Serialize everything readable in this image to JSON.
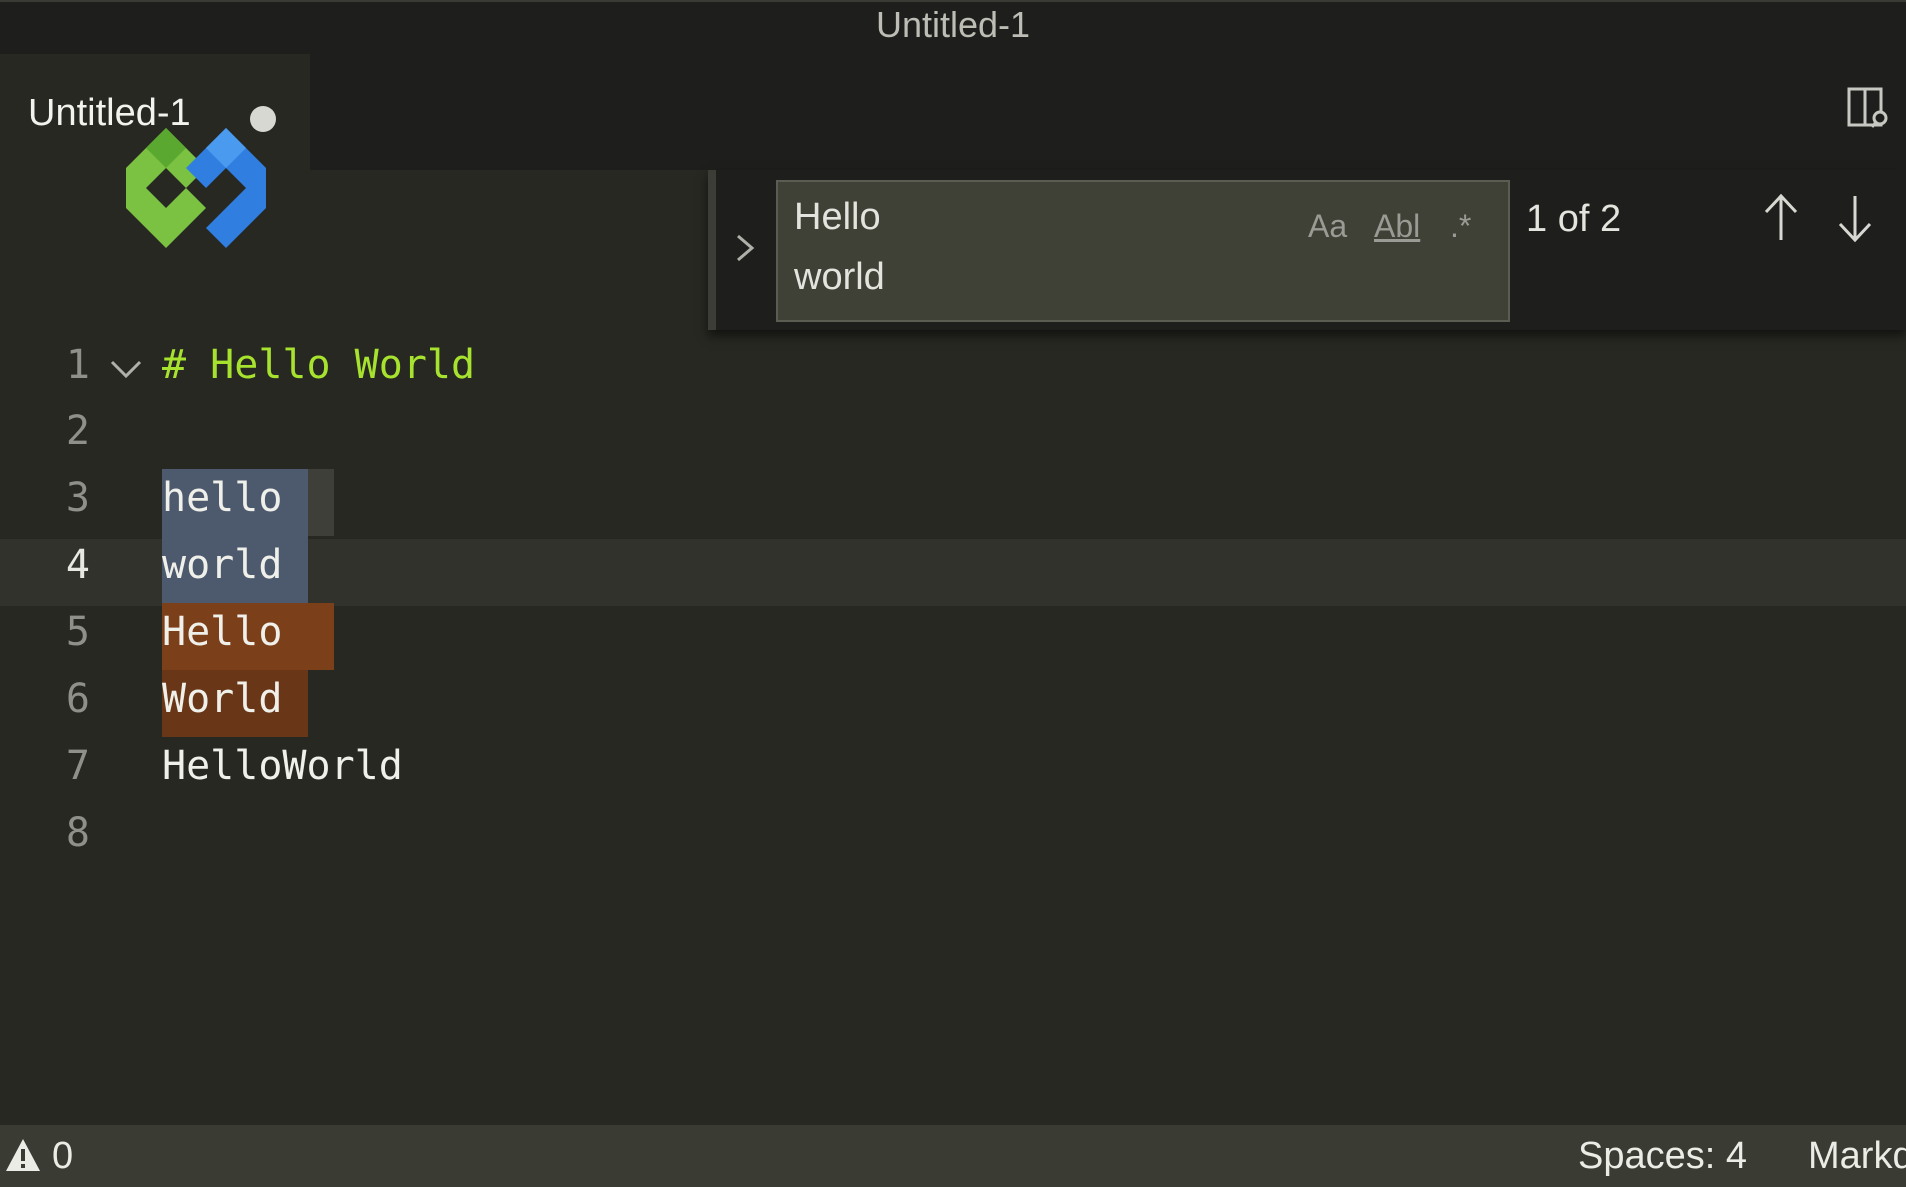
{
  "window": {
    "title": "Untitled-1"
  },
  "tabs": [
    {
      "label": "Untitled-1",
      "dirty": true
    }
  ],
  "icons": {
    "split_editor": "split-editor-icon",
    "fold": "chevron-down-icon",
    "find_toggle": "chevron-right-icon",
    "prev_match": "arrow-up-icon",
    "next_match": "arrow-down-icon",
    "warning": "warning-icon",
    "logo": "logo-icon"
  },
  "editor": {
    "lines": [
      {
        "number": "1",
        "text": "# Hello World"
      },
      {
        "number": "2",
        "text": ""
      },
      {
        "number": "3",
        "text": "hello"
      },
      {
        "number": "4",
        "text": "world"
      },
      {
        "number": "5",
        "text": "Hello"
      },
      {
        "number": "6",
        "text": "World"
      },
      {
        "number": "7",
        "text": "HelloWorld"
      },
      {
        "number": "8",
        "text": ""
      }
    ],
    "active_line": "4"
  },
  "find": {
    "query_line1": "Hello",
    "query_line2": "world",
    "match_case_label": "Aa",
    "whole_word_label": "Abl",
    "regex_label": ".*",
    "count": "1 of 2"
  },
  "status": {
    "warnings": "0",
    "indentation": "Spaces: 4",
    "language": "Markdown"
  },
  "colors": {
    "background": "#272822",
    "heading": "#a6e22e",
    "selection": "#4d5a6e",
    "match_highlight": "#7b3f1a",
    "status_bar": "#3a3b33"
  }
}
